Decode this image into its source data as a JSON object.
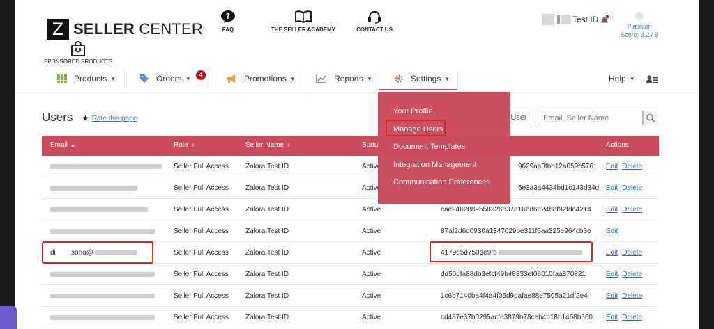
{
  "header": {
    "logo_letter": "Z",
    "logo_bold": "SELLER",
    "logo_rest": "CENTER",
    "faq": "FAQ",
    "academy": "THE SELLER ACADEMY",
    "contact": "CONTACT US",
    "sponsored": "SPONSORED PRODUCTS",
    "user_id_suffix": "Test ID",
    "tier_name": "Platinum",
    "tier_score": "Score: 3.2 / 5"
  },
  "nav": {
    "products": "Products",
    "orders": "Orders",
    "orders_badge": "4",
    "promotions": "Promotions",
    "reports": "Reports",
    "settings": "Settings",
    "help": "Help"
  },
  "settings_menu": [
    "Your Profile",
    "Manage Users",
    "Document Templates",
    "Integration Management",
    "Communication Preferences"
  ],
  "users": {
    "title": "Users",
    "rate_link": "Rate this page",
    "user_button": "User",
    "search_placeholder": "Email, Seller Name"
  },
  "table": {
    "headers": {
      "email": "Email",
      "role": "Role",
      "seller": "Seller Name",
      "status": "Statu",
      "actions": "Actions"
    },
    "rows": [
      {
        "email_visible": "",
        "role": "Seller Full Access",
        "seller": "Zalora Test ID",
        "status": "Active",
        "key": "9629aa3fbb12a059c576",
        "edit": "Edit",
        "delete": "Delete"
      },
      {
        "email_visible": "",
        "role": "Seller Full Access",
        "seller": "Zalora Test ID",
        "status": "Active",
        "key": "6e3a3a4434bd1c143d34d",
        "edit": "Edit",
        "delete": "Delete"
      },
      {
        "email_visible": "",
        "role": "Seller Full Access",
        "seller": "Zalora Test ID",
        "status": "Active",
        "key": "cae9462889558226e37a16ed6e24b8f92fdc4214",
        "edit": "Edit",
        "delete": "Delete"
      },
      {
        "email_visible": "",
        "role": "Seller Full Access",
        "seller": "Zalora Test ID",
        "status": "Active",
        "key": "87af2d6d0930a1347029be311f5aa325e964cb3e",
        "edit": "Edit",
        "delete": ""
      },
      {
        "email_visible": "di        sono@",
        "role": "Seller Full Access",
        "seller": "Zalora Test ID",
        "status": "Active",
        "key": "4179d5d750de9fb",
        "edit": "Edit",
        "delete": "Delete"
      },
      {
        "email_visible": "",
        "role": "Seller Full Access",
        "seller": "Zalora Test ID",
        "status": "Active",
        "key": "dd50dfa88db3efcf49b48333ef08010faa870821",
        "edit": "Edit",
        "delete": "Delete"
      },
      {
        "email_visible": "",
        "role": "Seller Full Access",
        "seller": "Zalora Test ID",
        "status": "Active",
        "key": "1c6b7140ba4f4a4f05d9dafae88e7505a21df2e4",
        "edit": "Edit",
        "delete": "Delete"
      },
      {
        "email_visible": "",
        "role": "Seller Full Access",
        "seller": "Zalora Test ID",
        "status": "Active",
        "key": "cd487e37b0295acfe3879b78ceb4b18b1468b560",
        "edit": "Edit",
        "delete": "Delete"
      }
    ]
  },
  "colors": {
    "accent": "#c94a5a",
    "link": "#3b6fb6",
    "highlight": "#e0231b"
  }
}
